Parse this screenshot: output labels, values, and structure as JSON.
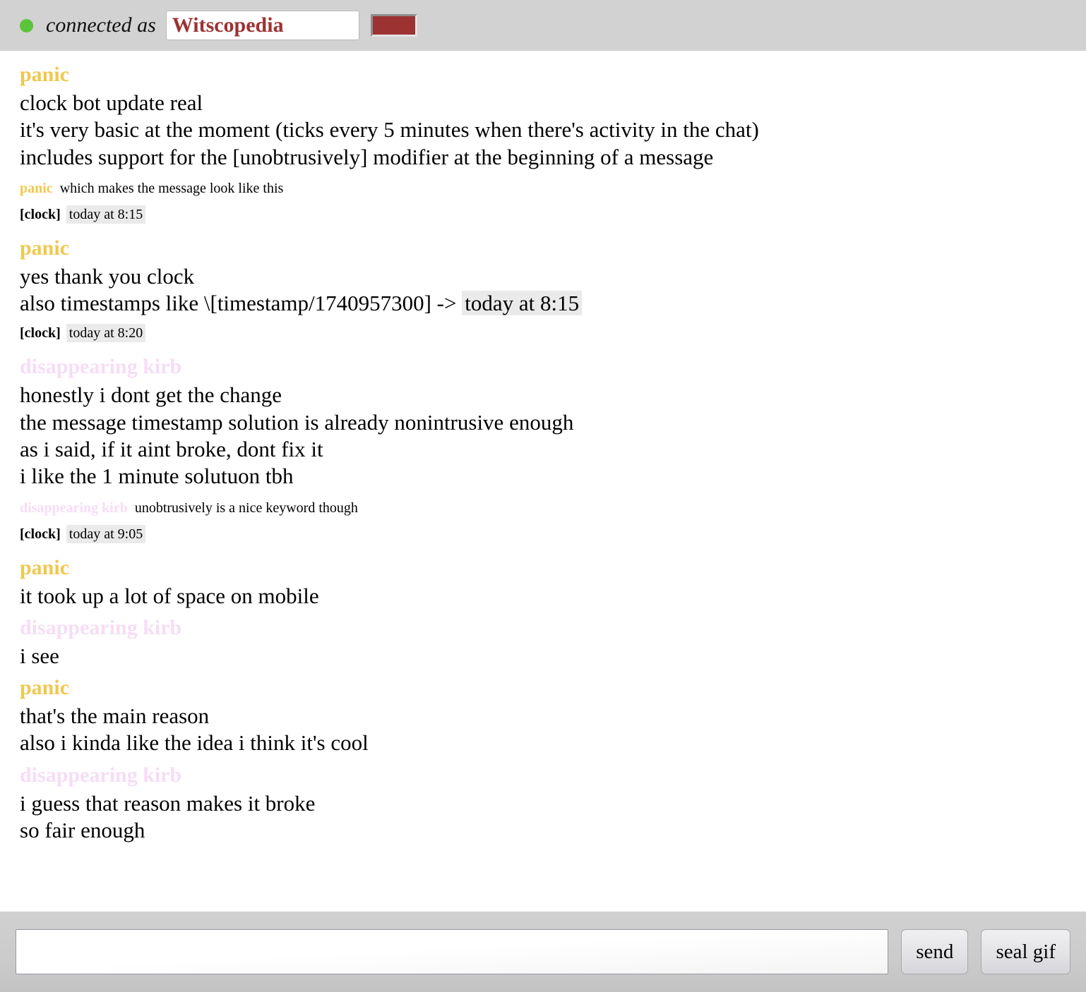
{
  "status_bar": {
    "connection_state": "connected",
    "connection_label": "connected as",
    "nickname": "Witscopedia",
    "nickname_placeholder": "nickname",
    "dot_color": "#5cc43a",
    "user_color": "#9d3232",
    "swatch_name": "user-color-swatch"
  },
  "colors": {
    "panic": "#f0c84e",
    "kirb": "#f6ddf6",
    "timestamp_highlight": "#eaeaea",
    "chrome": "#d2d2d2"
  },
  "messages": [
    {
      "type": "group",
      "author": "panic",
      "author_class": "panic",
      "lines": [
        "clock bot update real",
        "it's very basic at the moment (ticks every 5 minutes when there's activity in the chat)",
        "includes support for the [unobtrusively] modifier at the beginning of a message"
      ]
    },
    {
      "type": "compact",
      "author": "panic",
      "author_class": "panic",
      "text": "which makes the message look like this"
    },
    {
      "type": "clock",
      "tag": "[clock]",
      "timestamp": "today at 8:15"
    },
    {
      "type": "group",
      "author": "panic",
      "author_class": "panic",
      "lines": [
        "yes thank you clock"
      ],
      "timestamp_line": {
        "prefix": "also timestamps like \\[timestamp/1740957300] -> ",
        "chip": "today at 8:15"
      }
    },
    {
      "type": "clock",
      "tag": "[clock]",
      "timestamp": "today at 8:20"
    },
    {
      "type": "group",
      "author": "disappearing kirb",
      "author_class": "kirb",
      "lines": [
        "honestly i dont get the change",
        "the message timestamp solution is already nonintrusive enough",
        "as i said, if it aint broke, dont fix it",
        "i like the 1 minute solutuon tbh"
      ]
    },
    {
      "type": "compact",
      "author": "disappearing kirb",
      "author_class": "kirb",
      "text": "unobtrusively is a nice keyword though"
    },
    {
      "type": "clock",
      "tag": "[clock]",
      "timestamp": "today at 9:05"
    },
    {
      "type": "group",
      "author": "panic",
      "author_class": "panic",
      "lines": [
        "it took up a lot of space on mobile"
      ]
    },
    {
      "type": "group",
      "author": "disappearing kirb",
      "author_class": "kirb",
      "lines": [
        "i see"
      ]
    },
    {
      "type": "group",
      "author": "panic",
      "author_class": "panic",
      "lines": [
        "that's the main reason",
        "also i kinda like the idea i think it's cool"
      ]
    },
    {
      "type": "group",
      "author": "disappearing kirb",
      "author_class": "kirb",
      "lines": [
        "i guess that reason makes it broke",
        "so fair enough"
      ]
    }
  ],
  "composer": {
    "input_value": "",
    "input_placeholder": "",
    "send_label": "send",
    "seal_gif_label": "seal gif"
  }
}
